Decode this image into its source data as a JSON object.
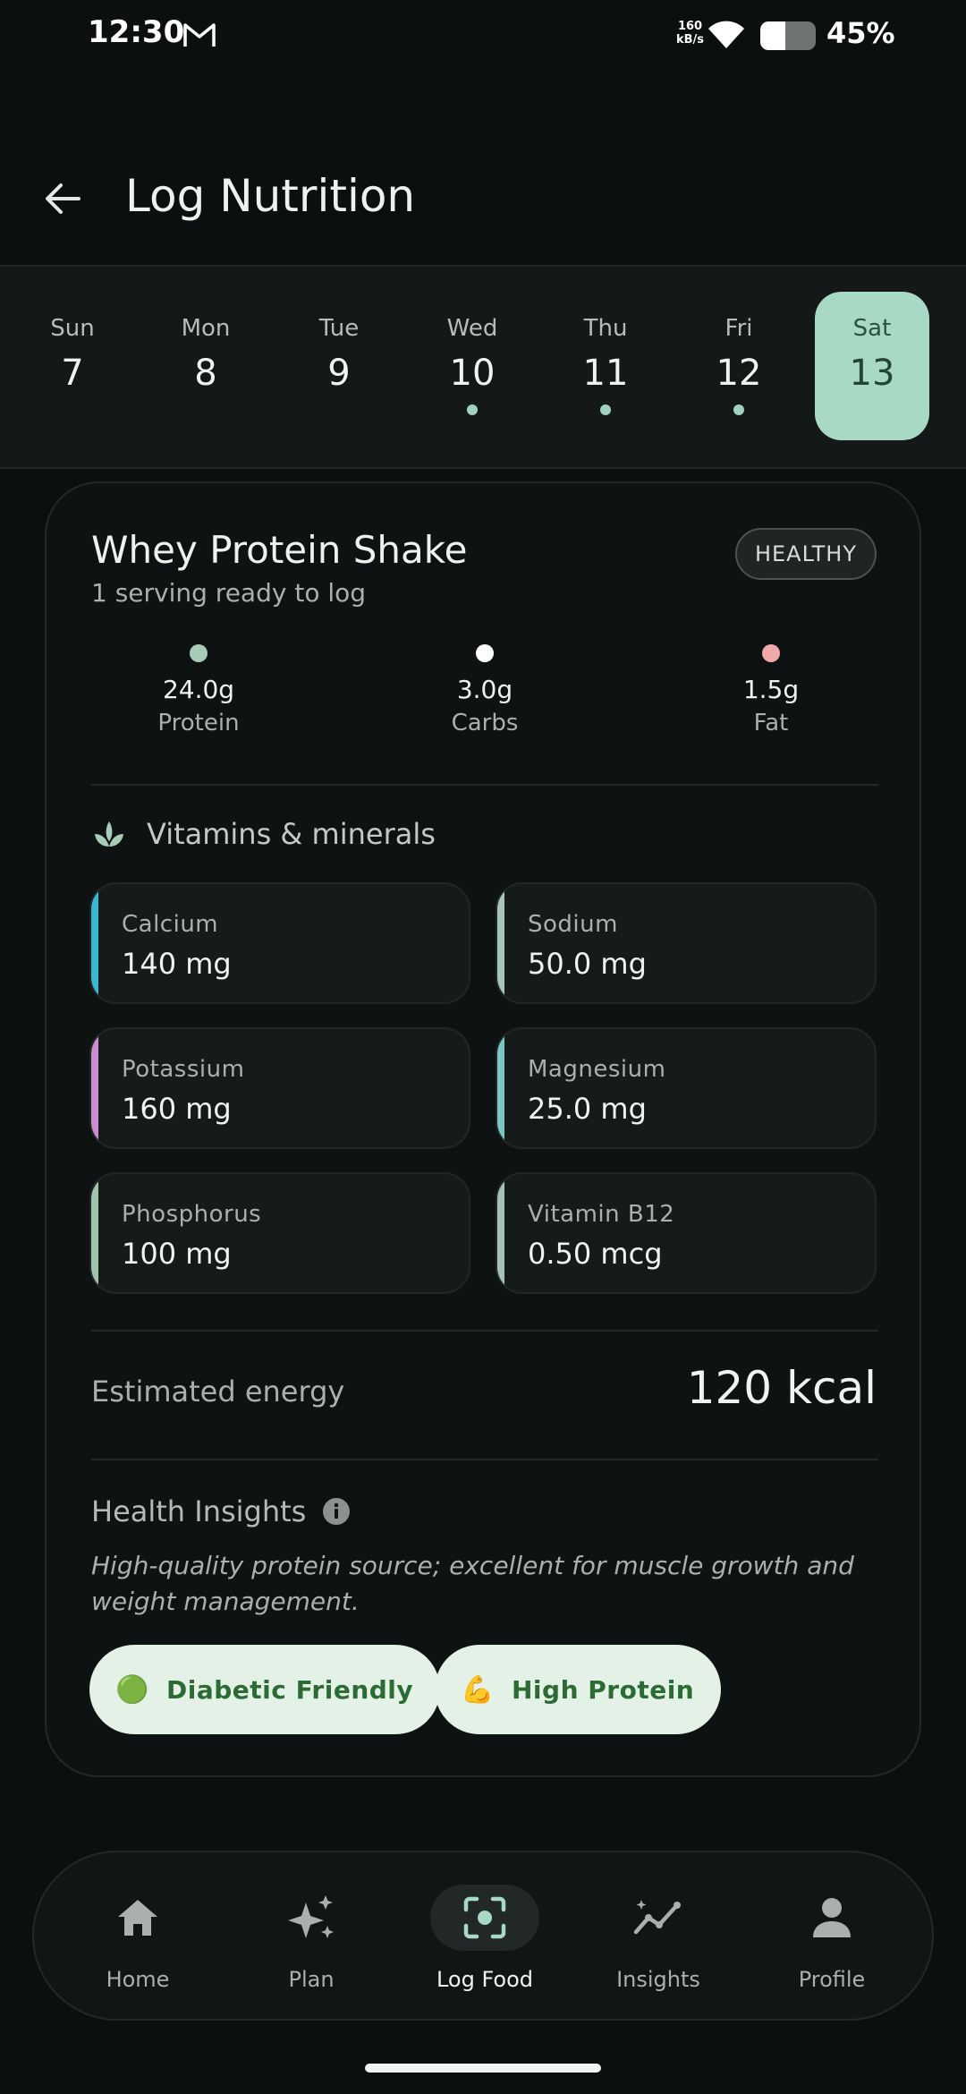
{
  "status_bar": {
    "time": "12:30",
    "network_speed_value": "160",
    "network_speed_unit": "kB/s",
    "battery_percent": "45%",
    "battery_level": 0.45
  },
  "header": {
    "title": "Log Nutrition",
    "back_icon": "arrow-left-icon"
  },
  "date_strip": {
    "days": [
      {
        "name": "Sun",
        "num": "7",
        "logged": false,
        "selected": false
      },
      {
        "name": "Mon",
        "num": "8",
        "logged": false,
        "selected": false
      },
      {
        "name": "Tue",
        "num": "9",
        "logged": false,
        "selected": false
      },
      {
        "name": "Wed",
        "num": "10",
        "logged": true,
        "selected": false
      },
      {
        "name": "Thu",
        "num": "11",
        "logged": true,
        "selected": false
      },
      {
        "name": "Fri",
        "num": "12",
        "logged": true,
        "selected": false
      },
      {
        "name": "Sat",
        "num": "13",
        "logged": false,
        "selected": true
      }
    ]
  },
  "food": {
    "name": "Whey Protein Shake",
    "serving_text": "1 serving ready to log",
    "badge": "HEALTHY",
    "macros": [
      {
        "value": "24.0g",
        "label": "Protein",
        "color": "#a8cbb8"
      },
      {
        "value": "3.0g",
        "label": "Carbs",
        "color": "#ffffff"
      },
      {
        "value": "1.5g",
        "label": "Fat",
        "color": "#f0a9a9"
      }
    ]
  },
  "vitamins": {
    "heading": "Vitamins & minerals",
    "icon": "sprout-icon",
    "items": [
      {
        "name": "Calcium",
        "value": "140 mg",
        "color": "#3ab6cf"
      },
      {
        "name": "Sodium",
        "value": "50.0 mg",
        "color": "#a9c5b8"
      },
      {
        "name": "Potassium",
        "value": "160 mg",
        "color": "#c98fd0"
      },
      {
        "name": "Magnesium",
        "value": "25.0 mg",
        "color": "#7cc7c3"
      },
      {
        "name": "Phosphorus",
        "value": "100 mg",
        "color": "#9fc4ae"
      },
      {
        "name": "Vitamin B12",
        "value": "0.50 mcg",
        "color": "#a7c1b6"
      }
    ]
  },
  "energy": {
    "label": "Estimated energy",
    "value": "120 kcal"
  },
  "health_insights": {
    "heading": "Health Insights",
    "icon": "info-icon",
    "text": "High-quality protein source; excellent for muscle growth and weight management.",
    "chips": [
      {
        "emoji": "🟢",
        "label": "Diabetic Friendly"
      },
      {
        "emoji": "💪",
        "label": "High Protein"
      }
    ]
  },
  "bottom_nav": {
    "items": [
      {
        "label": "Home",
        "icon": "home-icon",
        "active": false
      },
      {
        "label": "Plan",
        "icon": "sparkle-icon",
        "active": false
      },
      {
        "label": "Log Food",
        "icon": "scan-icon",
        "active": true
      },
      {
        "label": "Insights",
        "icon": "trend-icon",
        "active": false
      },
      {
        "label": "Profile",
        "icon": "person-icon",
        "active": false
      }
    ]
  }
}
